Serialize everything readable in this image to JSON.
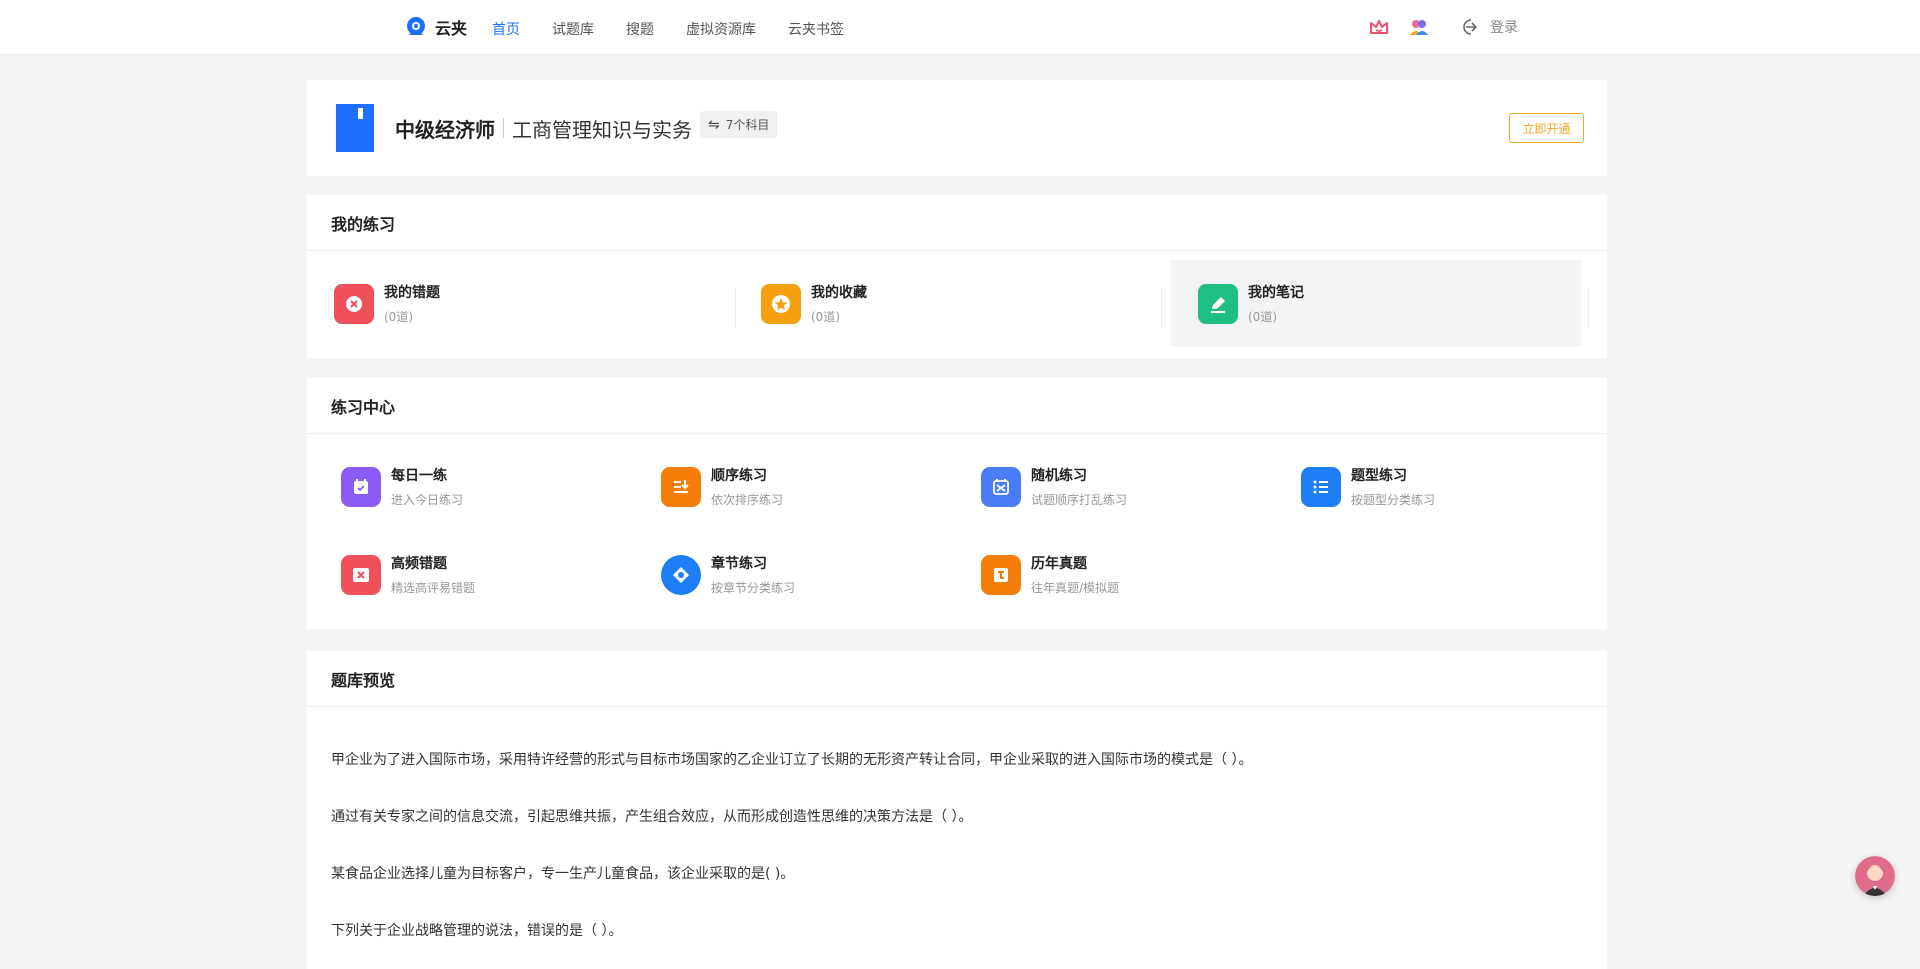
{
  "header": {
    "brand_name": "云夹",
    "nav": [
      "首页",
      "试题库",
      "搜题",
      "虚拟资源库",
      "云夹书签"
    ],
    "login_label": "登录"
  },
  "course": {
    "title": "中级经济师",
    "subject": "工商管理知识与实务",
    "subject_count": "7个科目",
    "open_button": "立即开通"
  },
  "my_practice": {
    "title": "我的练习",
    "items": [
      {
        "label": "我的错题",
        "count": "(0道)"
      },
      {
        "label": "我的收藏",
        "count": "(0道)"
      },
      {
        "label": "我的笔记",
        "count": "(0道)"
      }
    ]
  },
  "center": {
    "title": "练习中心",
    "items": [
      {
        "label": "每日一练",
        "desc": "进入今日练习"
      },
      {
        "label": "顺序练习",
        "desc": "依次排序练习"
      },
      {
        "label": "随机练习",
        "desc": "试题顺序打乱练习"
      },
      {
        "label": "题型练习",
        "desc": "按题型分类练习"
      },
      {
        "label": "高频错题",
        "desc": "精选高评易错题"
      },
      {
        "label": "章节练习",
        "desc": "按章节分类练习"
      },
      {
        "label": "历年真题",
        "desc": "往年真题/模拟题"
      }
    ]
  },
  "preview": {
    "title": "题库预览",
    "questions": [
      "甲企业为了进入国际市场，采用特许经营的形式与目标市场国家的乙企业订立了长期的无形资产转让合同，甲企业采取的进入国际市场的模式是（  ）。",
      "通过有关专家之间的信息交流，引起思维共振，产生组合效应，从而形成创造性思维的决策方法是（  ）。",
      "某食品企业选择儿童为目标客户，专一生产儿童食品，该企业采取的是( )。",
      "下列关于企业战略管理的说法，错误的是（  ）。"
    ]
  },
  "colors": {
    "accent": "#1e6fff",
    "orange": "#f5a623"
  }
}
